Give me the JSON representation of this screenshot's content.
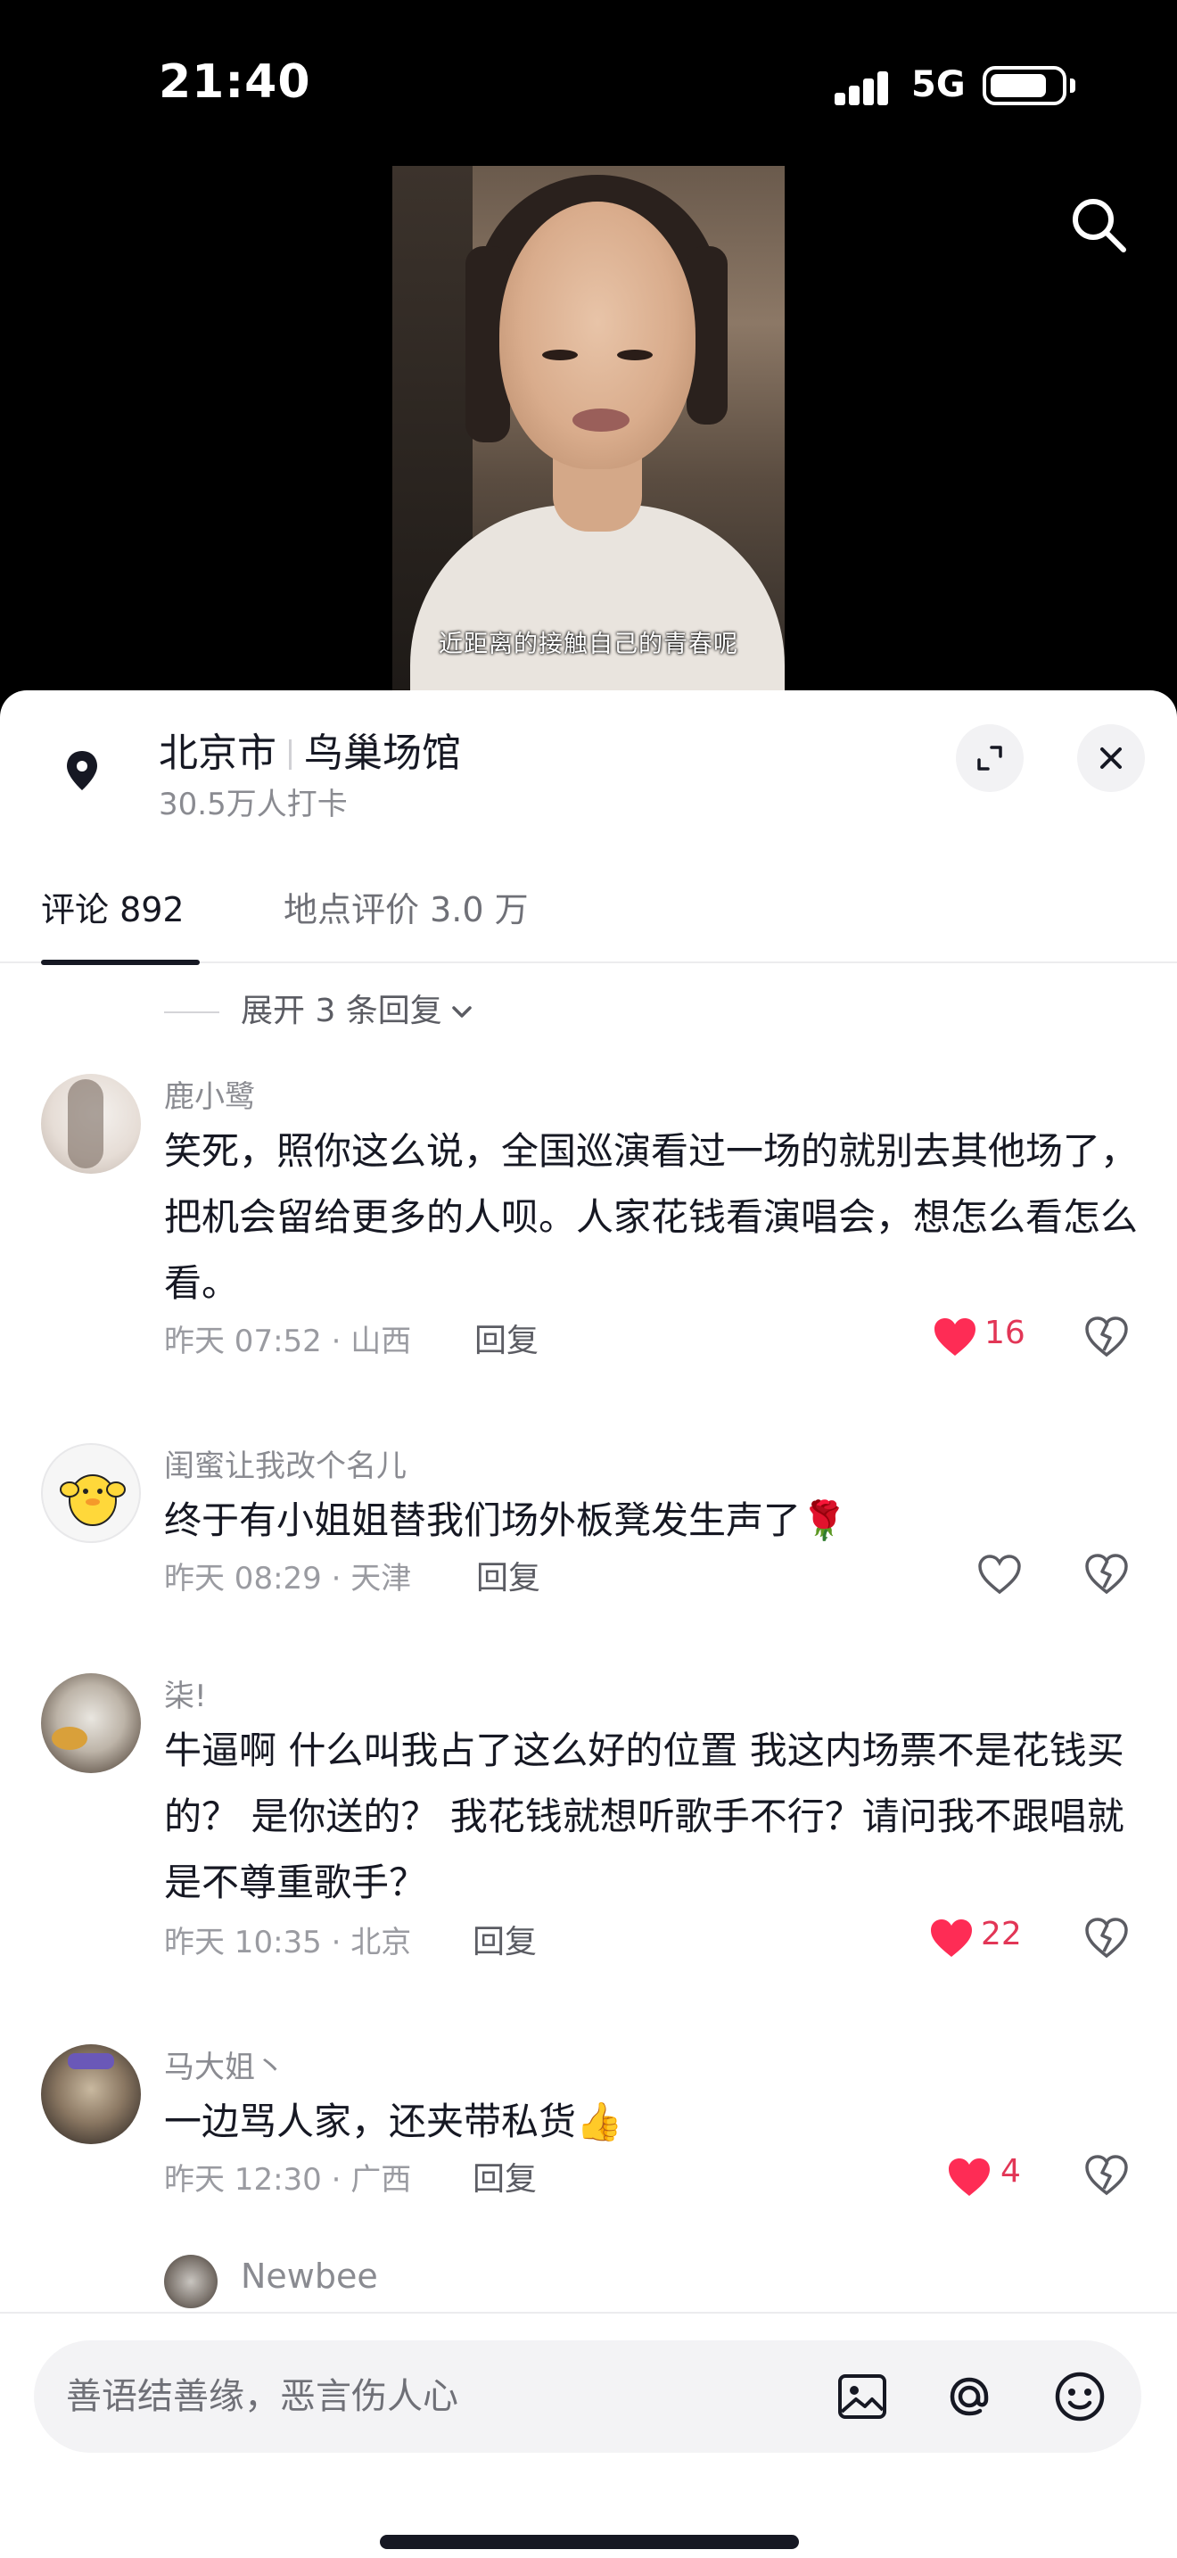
{
  "status_bar": {
    "time": "21:40",
    "network": "5G"
  },
  "video": {
    "subtitle": "近距离的接触自己的青春呢"
  },
  "location": {
    "city": "北京市",
    "venue": "鸟巢场馆",
    "checkins": "30.5万人打卡"
  },
  "tabs": [
    {
      "label": "评论 892",
      "active": true
    },
    {
      "label": "地点评价 3.0 万",
      "active": false
    }
  ],
  "expand_replies": "展开 3 条回复",
  "comments": [
    {
      "name": "鹿小鹭",
      "text": "笑死，照你这么说，全国巡演看过一场的就别去其他场了，把机会留给更多的人呗。人家花钱看演唱会，想怎么看怎么看。",
      "meta": "昨天 07:52 · 山西",
      "reply": "回复",
      "likes": "16",
      "liked": true
    },
    {
      "name": "闺蜜让我改个名儿",
      "text": "终于有小姐姐替我们场外板凳发生声了🌹",
      "meta": "昨天 08:29 · 天津",
      "reply": "回复",
      "likes": "",
      "liked": false
    },
    {
      "name": "柒!",
      "text": "牛逼啊 什么叫我占了这么好的位置 我这内场票不是花钱买的？ 是你送的？ 我花钱就想听歌手不行？请问我不跟唱就是不尊重歌手？",
      "meta": "昨天 10:35 · 北京",
      "reply": "回复",
      "likes": "22",
      "liked": true
    },
    {
      "name": "马大姐丶",
      "text": "一边骂人家，还夹带私货👍",
      "meta": "昨天 12:30 · 广西",
      "reply": "回复",
      "likes": "4",
      "liked": true
    }
  ],
  "next_comment_name": "Newbee",
  "input": {
    "placeholder": "善语结善缘，恶言伤人心"
  },
  "colors": {
    "like": "#fe2c55",
    "text": "#161823",
    "muted": "#8a8b91"
  },
  "icons": [
    "search-icon",
    "location-pin-icon",
    "expand-icon",
    "close-icon",
    "heart-icon",
    "dislike-icon",
    "image-icon",
    "at-icon",
    "emoji-icon"
  ]
}
